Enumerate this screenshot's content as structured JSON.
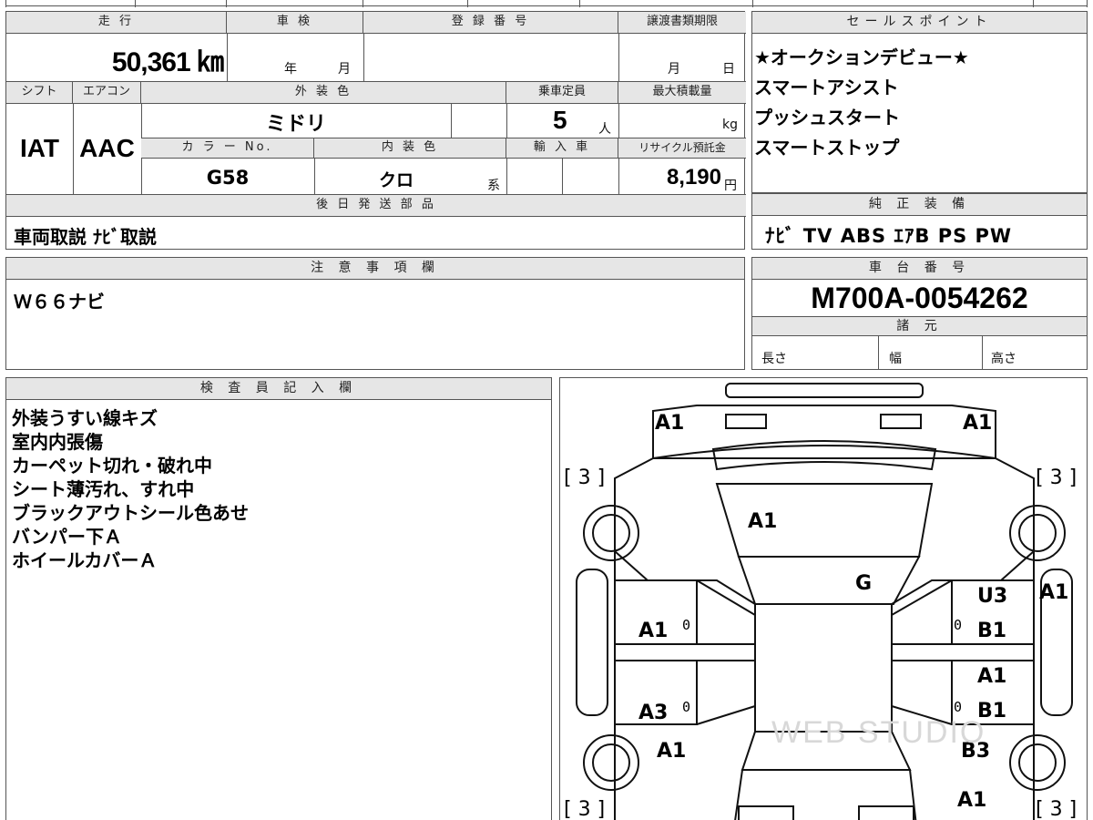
{
  "header": {
    "mileage_label": "走 行",
    "mileage_value": "50,361 ㎞",
    "inspection_label": "車 検",
    "inspection_year": "年",
    "inspection_month": "月",
    "registration_label": "登 録 番 号",
    "transfer_deadline_label": "譲渡書類期限",
    "transfer_month": "月",
    "transfer_day": "日"
  },
  "specs": {
    "shift_label": "シフト",
    "shift_value": "IAT",
    "aircon_label": "エアコン",
    "aircon_value": "AAC",
    "exterior_color_label": "外 装 色",
    "exterior_color_value": "ミドリ",
    "capacity_label": "乗車定員",
    "capacity_value": "5",
    "capacity_unit": "人",
    "max_load_label": "最大積載量",
    "max_load_unit": "kg",
    "color_no_label": "カ ラ ー No.",
    "color_no_value": "G58",
    "interior_color_label": "内 装 色",
    "interior_color_value": "クロ",
    "interior_color_suffix": "系",
    "import_label": "輸 入 車",
    "recycle_label": "リサイクル預託金",
    "recycle_value": "8,190",
    "recycle_unit": "円"
  },
  "later_parts": {
    "label": "後 日 発 送 部 品",
    "value": "車両取説 ﾅﾋﾞ取説"
  },
  "sales_points": {
    "label": "セールスポイント",
    "items": [
      "★オークションデビュー★",
      "スマートアシスト",
      "プッシュスタート",
      "スマートストップ"
    ]
  },
  "equipment": {
    "label": "純 正 装 備",
    "value": "ﾅﾋﾞ TV ABS ｴｱB PS PW"
  },
  "notes": {
    "label": "注 意 事 項 欄",
    "value": "Ｗ６６ナビ"
  },
  "chassis": {
    "label": "車 台 番 号",
    "value": "M700A-0054262"
  },
  "dimensions": {
    "label": "諸 元",
    "length_label": "長さ",
    "width_label": "幅",
    "height_label": "高さ"
  },
  "inspector": {
    "label": "検 査 員 記 入 欄",
    "lines": [
      "外装うすい線キズ",
      "室内内張傷",
      "カーペット切れ・破れ中",
      "シート薄汚れ、すれ中",
      "ブラックアウトシール色あせ",
      "バンパー下Ａ",
      "ホイールカバーＡ"
    ]
  },
  "diagram": {
    "marks": {
      "front_left": "A1",
      "front_right": "A1",
      "hood": "A1",
      "windshield": "G",
      "left_front_door": "A1",
      "left_rear_door": "A3",
      "left_rear_corner": "A1",
      "right_front_door_top": "U3",
      "right_front_door": "B1",
      "right_rear_door_top": "A1",
      "right_rear_door": "B1",
      "right_rear_corner": "B3",
      "right_rear_bottom": "A1",
      "right_side": "A1"
    },
    "tire_tl": "[ 3 ]",
    "tire_tr": "[ 3 ]",
    "tire_bl": "[ 3 ]",
    "tire_br": "[ 3 ]",
    "zero_mark": "0",
    "watermark": "WEB STUDIO"
  }
}
